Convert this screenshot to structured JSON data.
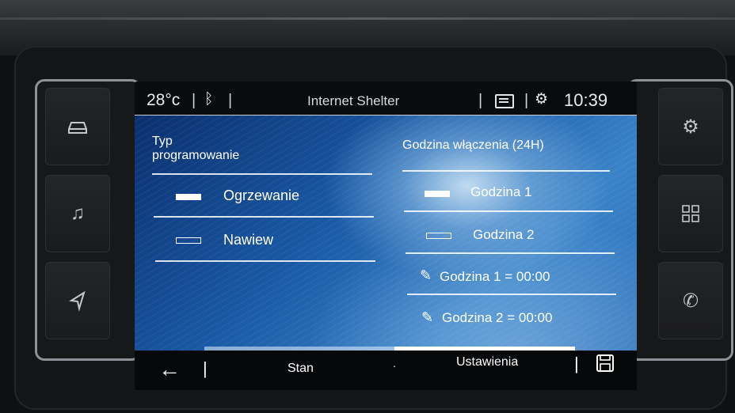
{
  "status": {
    "temperature": "28°c",
    "bluetooth_icon": "bluetooth-icon",
    "source_title": "Internet Shelter",
    "clock": "10:39"
  },
  "left_column": {
    "header_line1": "Typ",
    "header_line2": "programowanie",
    "options": [
      {
        "label": "Ogrzewanie",
        "selected": true
      },
      {
        "label": "Nawiew",
        "selected": false
      }
    ]
  },
  "right_column": {
    "header": "Godzina włączenia (24H)",
    "options": [
      {
        "label": "Godzina 1",
        "selected": true
      },
      {
        "label": "Godzina 2",
        "selected": false
      }
    ],
    "edit_rows": [
      {
        "label": "Godzina 1 = 00:00"
      },
      {
        "label": "Godzina 2 = 00:00"
      }
    ]
  },
  "bottom": {
    "back_icon": "back-arrow-icon",
    "tab_stan": "Stan",
    "tab_ustawienia": "Ustawienia",
    "save_icon": "save-icon",
    "active_tab": "Ustawienia"
  },
  "hardware_buttons": {
    "left": [
      "car-icon",
      "music-note-icon",
      "navigation-icon"
    ],
    "right": [
      "settings-icon",
      "apps-grid-icon",
      "phone-icon"
    ]
  },
  "colors": {
    "accent_white": "#ffffff",
    "screen_blue": "#1a5aa6",
    "bar_dark": "#0a0b0d"
  }
}
